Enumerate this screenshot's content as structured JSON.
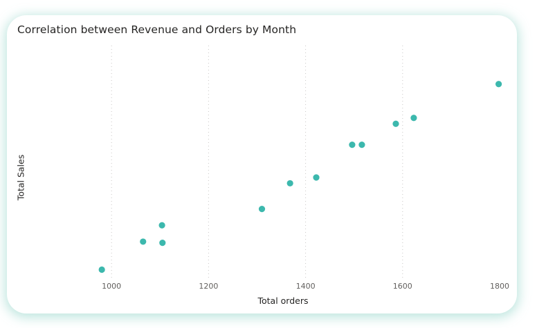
{
  "chart_data": {
    "type": "scatter",
    "title": "Correlation between Revenue and Orders by Month",
    "xlabel": "Total orders",
    "ylabel": "Total Sales",
    "xlim": [
      830,
      1800
    ],
    "ylim": [
      0,
      100
    ],
    "x_ticks": [
      1000,
      1200,
      1400,
      1600,
      1800
    ],
    "y_ticks_shown": false,
    "grid": "vertical dotted",
    "legend": "none",
    "color": "#3cb8ad",
    "points": [
      {
        "x": 980,
        "y": 4
      },
      {
        "x": 1065,
        "y": 16
      },
      {
        "x": 1105,
        "y": 15.5
      },
      {
        "x": 1104,
        "y": 23
      },
      {
        "x": 1310,
        "y": 30
      },
      {
        "x": 1368,
        "y": 41
      },
      {
        "x": 1422,
        "y": 43.5
      },
      {
        "x": 1496,
        "y": 57.5
      },
      {
        "x": 1516,
        "y": 57.5
      },
      {
        "x": 1586,
        "y": 66.5
      },
      {
        "x": 1623,
        "y": 69
      },
      {
        "x": 1798,
        "y": 83.5
      }
    ]
  }
}
